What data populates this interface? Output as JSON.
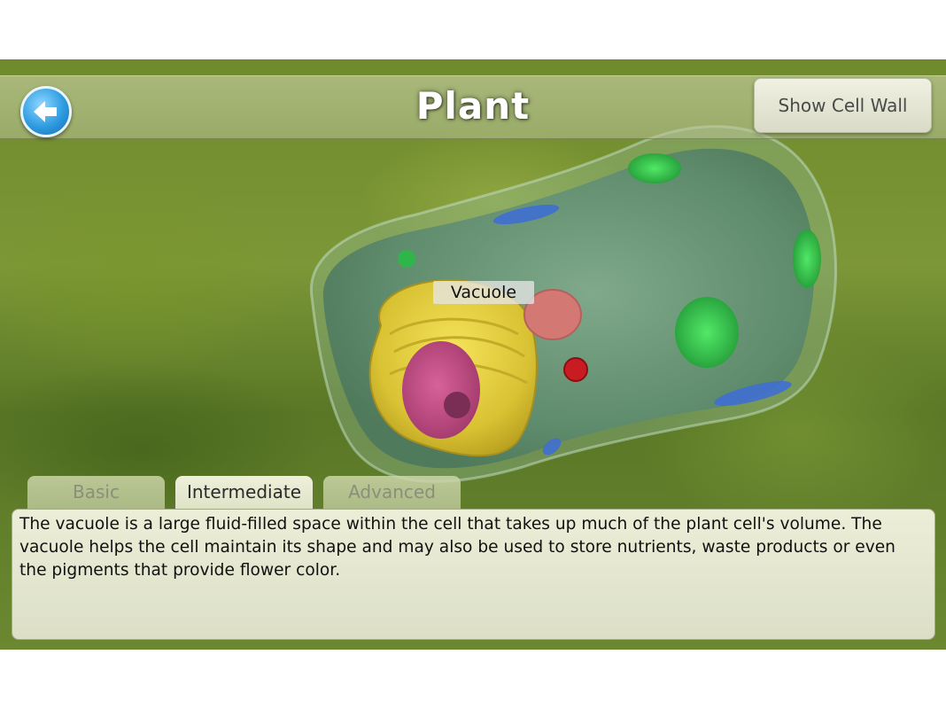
{
  "header": {
    "title": "Plant",
    "back_icon": "back-arrow-icon",
    "show_cell_wall_label": "Show Cell Wall"
  },
  "cell_view": {
    "selected_label": "Vacuole"
  },
  "tabs": [
    {
      "label": "Basic",
      "selected": false
    },
    {
      "label": "Intermediate",
      "selected": true
    },
    {
      "label": "Advanced",
      "selected": false
    }
  ],
  "description": {
    "text": "The vacuole is a large fluid-filled space within the cell that takes up much of the plant cell's volume. The vacuole helps the cell maintain its shape and may also be used to store nutrients, waste products or even the pigments that provide flower color."
  },
  "colors": {
    "accent_blue": "#2e9be0",
    "cytoplasm": "#6e9b7c",
    "vacuole": "#e2cf3a",
    "nucleus": "#c44f86",
    "chloroplast": "#39d84b"
  }
}
